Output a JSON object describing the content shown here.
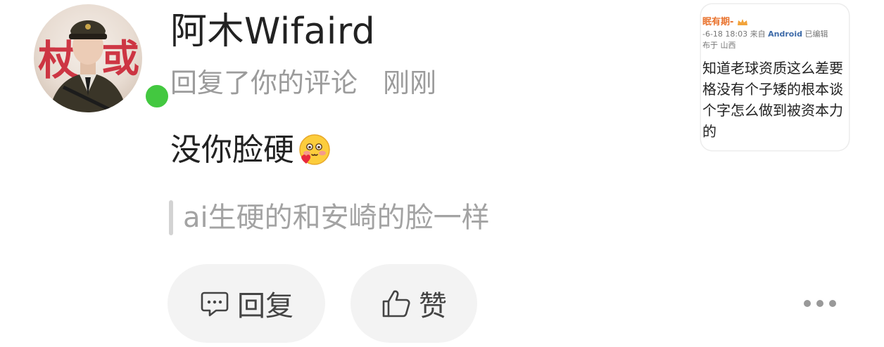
{
  "comment": {
    "author_name": "阿木Wifaird",
    "action_text": "回复了你的评论",
    "time_text": "刚刚",
    "reply_text": "没你脸硬",
    "emoji": "blushing-heart-emoji",
    "quoted_text": "ai生硬的和安崎的脸一样",
    "online_color": "#43c840"
  },
  "actions": {
    "reply_label": "回复",
    "like_label": "赞"
  },
  "preview_card": {
    "author": "眠有期-",
    "meta": "-6-18 18:03 来自",
    "client": "Android",
    "edited": "已编辑",
    "location": "布于 山西",
    "body": "知道老球资质这么差要格没有个子矮的根本谈个字怎么做到被资本力的"
  }
}
